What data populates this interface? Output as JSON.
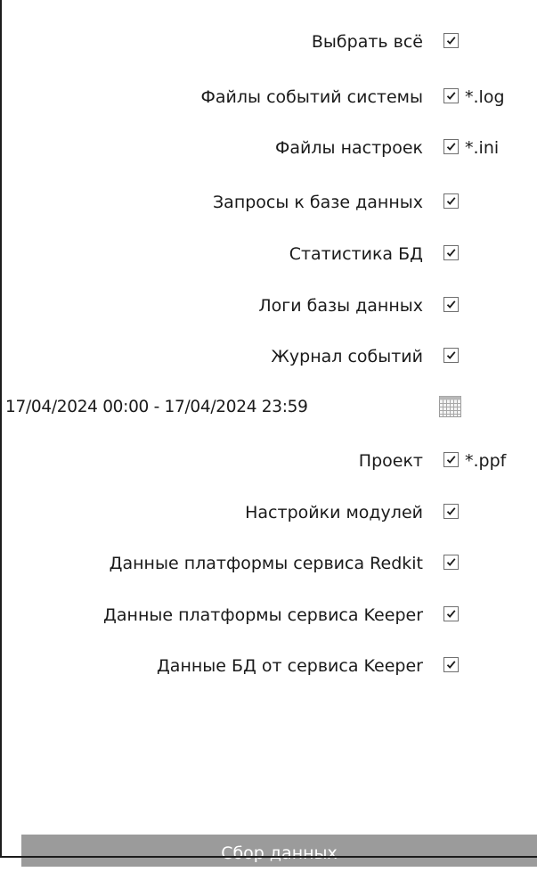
{
  "options": [
    {
      "label": "Выбрать всё",
      "checked": true,
      "ext": ""
    },
    {
      "label": "Файлы событий системы",
      "checked": true,
      "ext": "*.log"
    },
    {
      "label": "Файлы настроек",
      "checked": true,
      "ext": "*.ini"
    },
    {
      "label": "Запросы к базе данных",
      "checked": true,
      "ext": ""
    },
    {
      "label": "Статистика БД",
      "checked": true,
      "ext": ""
    },
    {
      "label": "Логи базы данных",
      "checked": true,
      "ext": ""
    },
    {
      "label": "Журнал событий",
      "checked": true,
      "ext": ""
    }
  ],
  "date_range": {
    "value": "17/04/2024 00:00 - 17/04/2024 23:59",
    "icon": "calendar-icon"
  },
  "options_after": [
    {
      "label": "Проект",
      "checked": true,
      "ext": "*.ppf"
    },
    {
      "label": "Настройки модулей",
      "checked": true,
      "ext": ""
    },
    {
      "label": "Данные платформы сервиса Redkit",
      "checked": true,
      "ext": ""
    },
    {
      "label": "Данные платформы сервиса Keeper",
      "checked": true,
      "ext": ""
    },
    {
      "label": "Данные БД от сервиса Keeper",
      "checked": true,
      "ext": ""
    }
  ],
  "collect_button": {
    "label": "Сбор данных"
  },
  "colors": {
    "button_bg": "#9b9b9b",
    "checkbox_border": "#6f6f6f",
    "check_mark": "#1a1a1a",
    "frame": "#1c1c1c"
  }
}
